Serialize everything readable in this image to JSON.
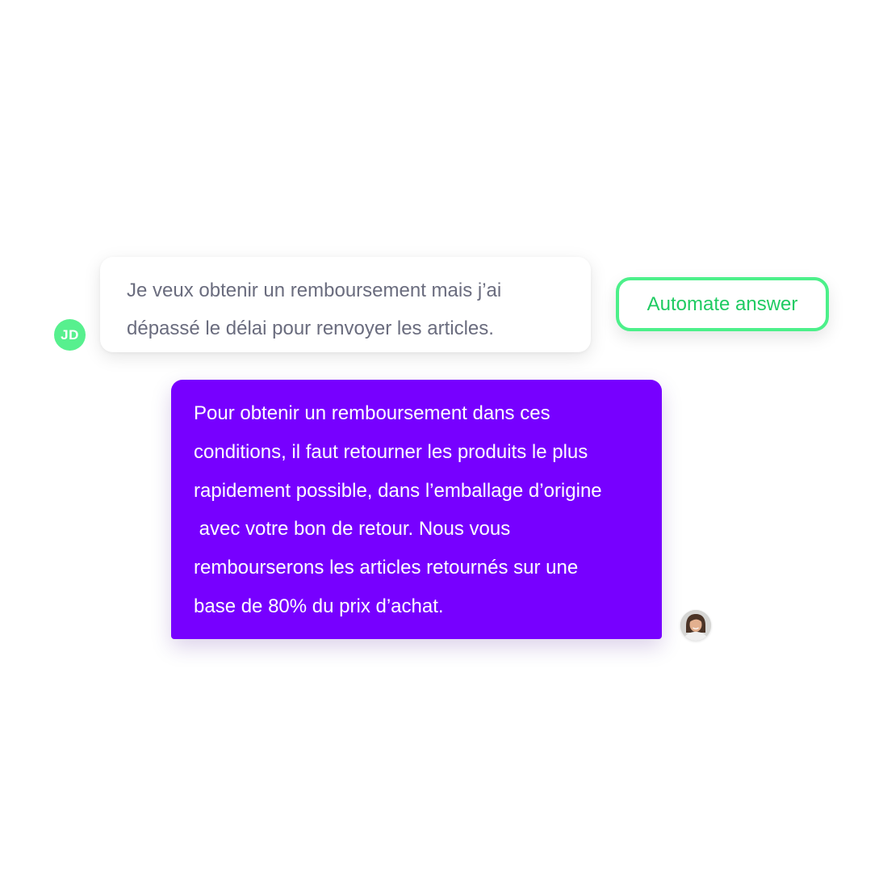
{
  "customer": {
    "initials": "JD",
    "message_lines": [
      "Je veux obtenir un remboursement mais j’ai",
      "dépassé le délai pour renvoyer les articles."
    ]
  },
  "action": {
    "automate_label": "Automate answer"
  },
  "agent": {
    "reply_lines": [
      "Pour obtenir un remboursement dans ces",
      "conditions, il faut retourner les produits le plus",
      "rapidement possible, dans l’emballage d’origine",
      " avec votre bon de retour. Nous vous",
      "rembourserons les articles retournés sur une",
      "base de 80% du prix d’achat."
    ],
    "avatar_icon": "agent-photo-icon"
  },
  "colors": {
    "accent_purple": "#7700ff",
    "accent_green": "#4cf08a",
    "avatar_green": "#57f08e",
    "text_gray": "#6a6c7e"
  }
}
